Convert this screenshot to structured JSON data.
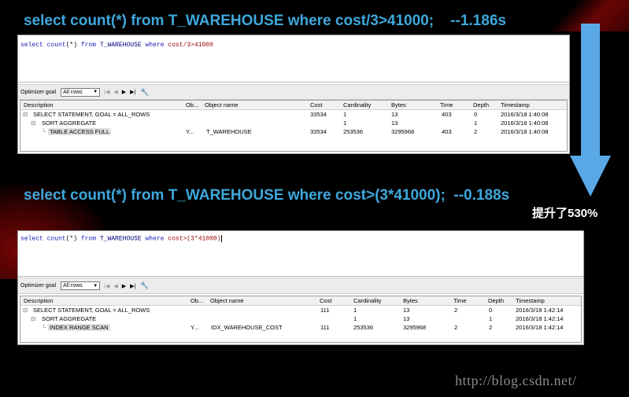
{
  "headline1": "select count(*) from T_WAREHOUSE where cost/3>41000;    --1.186s",
  "headline2": "select count(*) from T_WAREHOUSE where cost>(3*41000);  --0.188s",
  "improvement": "提升了530%",
  "watermark": "http://blog.csdn.net/",
  "columns": {
    "description": "Description",
    "object_owner": "Ob...",
    "object_name": "Object name",
    "cost": "Cost",
    "cardinality": "Cardinality",
    "bytes": "Bytes",
    "time": "Time",
    "depth": "Depth",
    "timestamp": "Timestamp"
  },
  "toolbar": {
    "goal_label": "Optimizer goal",
    "goal_value": "All rows"
  },
  "query1": {
    "sql": {
      "kw1": "select count",
      "p": "(*)",
      "kw2": "from",
      "tbl": "T_WAREHOUSE",
      "kw3": "where",
      "cond": "cost/3>41000"
    },
    "rows": [
      {
        "desc": "SELECT STATEMENT, GOAL = ALL_ROWS",
        "owner": "",
        "object": "",
        "cost": "33534",
        "card": "1",
        "bytes": "13",
        "time": "403",
        "depth": "0",
        "ts": "2016/3/18 1:40:08"
      },
      {
        "desc": "SORT AGGREGATE",
        "owner": "",
        "object": "",
        "cost": "",
        "card": "1",
        "bytes": "13",
        "time": "",
        "depth": "1",
        "ts": "2016/3/18 1:40:08"
      },
      {
        "desc": "TABLE ACCESS FULL",
        "owner": "Y...",
        "object": "T_WAREHOUSE",
        "cost": "33534",
        "card": "253536",
        "bytes": "3295968",
        "time": "403",
        "depth": "2",
        "ts": "2016/3/18 1:40:08"
      }
    ]
  },
  "query2": {
    "sql": {
      "kw1": "select count",
      "p": "(*)",
      "kw2": "from",
      "tbl": "T_WAREHOUSE",
      "kw3": "where",
      "cond": "cost>(3*41000)"
    },
    "rows": [
      {
        "desc": "SELECT STATEMENT, GOAL = ALL_ROWS",
        "owner": "",
        "object": "",
        "cost": "111",
        "card": "1",
        "bytes": "13",
        "time": "2",
        "depth": "0",
        "ts": "2016/3/18 1:42:14"
      },
      {
        "desc": "SORT AGGREGATE",
        "owner": "",
        "object": "",
        "cost": "",
        "card": "1",
        "bytes": "13",
        "time": "",
        "depth": "1",
        "ts": "2016/3/18 1:42:14"
      },
      {
        "desc": "INDEX RANGE SCAN",
        "owner": "Y...",
        "object": "IDX_WAREHOUSE_COST",
        "cost": "111",
        "card": "253536",
        "bytes": "3295968",
        "time": "2",
        "depth": "2",
        "ts": "2016/3/18 1:42:14"
      }
    ]
  },
  "colors": {
    "headline": "#3ea8dc",
    "arrow": "#5aa9e6",
    "background": "#000000"
  }
}
